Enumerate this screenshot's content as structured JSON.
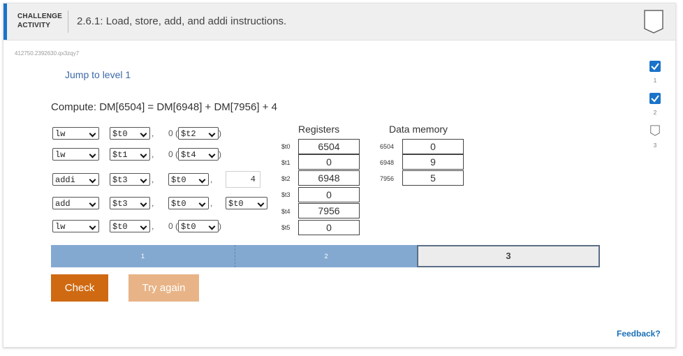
{
  "header": {
    "activity_label_line1": "CHALLENGE",
    "activity_label_line2": "ACTIVITY",
    "title": "2.6.1: Load, store, add, and addi instructions."
  },
  "identifier": "412750.2392630.qx3zqy7",
  "jump_link": "Jump to level 1",
  "compute_text": "Compute: DM[6504] = DM[6948] + DM[7956] + 4",
  "instructions": [
    {
      "op": "lw",
      "rt": "$t0",
      "offset_text": "0 (",
      "base": "$t2",
      "close": ")"
    },
    {
      "op": "lw",
      "rt": "$t1",
      "offset_text": "0 (",
      "base": "$t4",
      "close": ")"
    },
    {
      "op": "addi",
      "rt": "$t3",
      "rs": "$t0",
      "imm": "4"
    },
    {
      "op": "add",
      "rd": "$t3",
      "rs": "$t0",
      "rt": "$t0"
    },
    {
      "op": "lw",
      "rt": "$t0",
      "offset_text": "0 (",
      "base": "$t0",
      "close": ")"
    }
  ],
  "comma": ",",
  "registers": {
    "title": "Registers",
    "rows": [
      {
        "name": "$t0",
        "value": "6504"
      },
      {
        "name": "$t1",
        "value": "0"
      },
      {
        "name": "$t2",
        "value": "6948"
      },
      {
        "name": "$t3",
        "value": "0"
      },
      {
        "name": "$t4",
        "value": "7956"
      },
      {
        "name": "$t5",
        "value": "0"
      }
    ]
  },
  "data_memory": {
    "title": "Data memory",
    "rows": [
      {
        "address": "6504",
        "value": "0"
      },
      {
        "address": "6948",
        "value": "9"
      },
      {
        "address": "7956",
        "value": "5"
      }
    ]
  },
  "progress": {
    "segments": [
      "1",
      "2",
      "3"
    ],
    "current": 3
  },
  "buttons": {
    "check": "Check",
    "try_again": "Try again"
  },
  "feedback": "Feedback?",
  "levels": [
    {
      "num": "1",
      "completed": true
    },
    {
      "num": "2",
      "completed": true
    },
    {
      "num": "3",
      "completed": false
    }
  ],
  "colors": {
    "accent": "#1a73c9",
    "check_button": "#cf6a12",
    "try_again_button": "#e8b487",
    "progress_done": "#84a9d1"
  }
}
